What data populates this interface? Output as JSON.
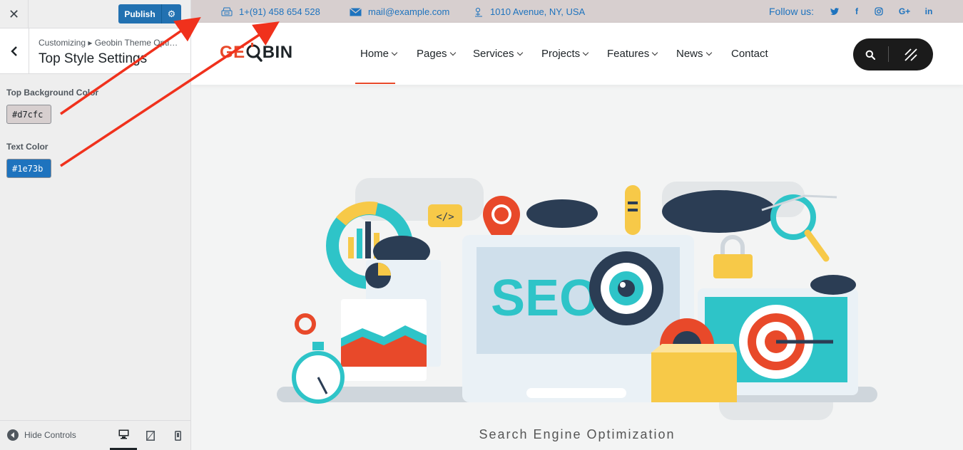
{
  "sidebar": {
    "close_icon": "close-icon",
    "publish_label": "Publish",
    "breadcrumb": "Customizing ▸ Geobin Theme Opti…",
    "section_title": "Top Style Settings",
    "controls": [
      {
        "label": "Top Background Color",
        "value": "#d7cfc",
        "color": "#d7cfcf"
      },
      {
        "label": "Text Color",
        "value": "#1e73b",
        "color": "#1e73be"
      }
    ],
    "footer": {
      "hide_label": "Hide Controls"
    }
  },
  "topbar": {
    "phone": "1+(91) 458 654 528",
    "email": "mail@example.com",
    "address": "1010 Avenue, NY, USA",
    "follow_label": "Follow us:",
    "social": [
      "twitter-icon",
      "facebook-icon",
      "instagram-icon",
      "google-plus-icon",
      "linkedin-icon"
    ],
    "bg_color": "#d7cfcf",
    "text_color": "#1e73be"
  },
  "navbar": {
    "logo": {
      "left": "GE",
      "right": "BIN"
    },
    "items": [
      {
        "label": "Home",
        "dropdown": true
      },
      {
        "label": "Pages",
        "dropdown": true
      },
      {
        "label": "Services",
        "dropdown": true
      },
      {
        "label": "Projects",
        "dropdown": true
      },
      {
        "label": "Features",
        "dropdown": true
      },
      {
        "label": "News",
        "dropdown": true
      },
      {
        "label": "Contact",
        "dropdown": false
      }
    ],
    "active": "Home",
    "accent": "#e8492a"
  },
  "hero": {
    "badge": "SEO",
    "caption": "Search Engine Optimization"
  }
}
